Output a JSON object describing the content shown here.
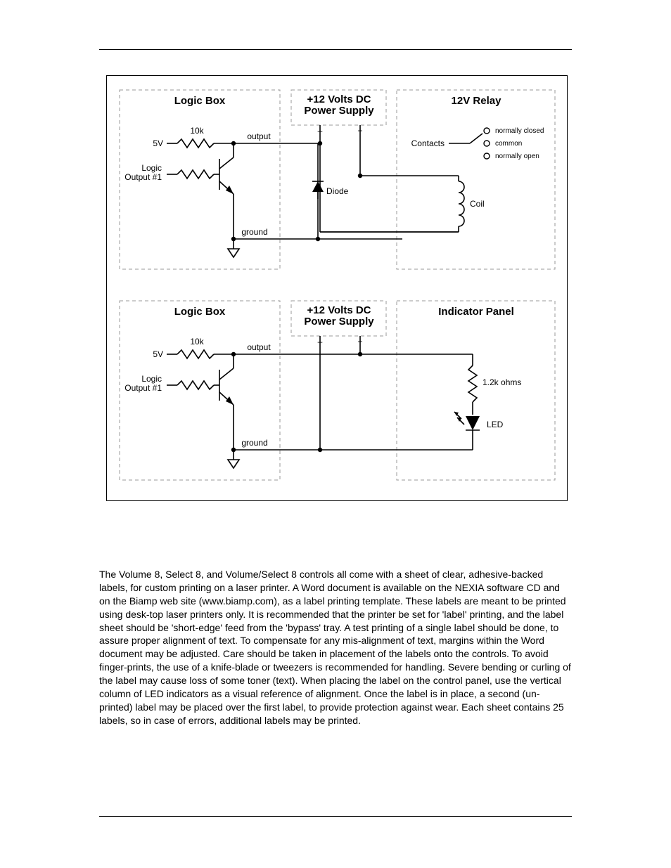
{
  "diagrams": {
    "top": {
      "logic_box_title": "Logic Box",
      "power_supply_title": "+12 Volts DC\nPower Supply",
      "right_title": "12V Relay",
      "r1_value": "10k",
      "output_label": "output",
      "v_label": "5V",
      "logic_output_label": "Logic\nOutput #1",
      "ground_label": "ground",
      "diode_label": "Diode",
      "coil_label": "Coil",
      "contacts_label": "Contacts",
      "nc_label": "normally closed",
      "common_label": "common",
      "no_label": "normally open",
      "ps_minus": "–",
      "ps_plus": "+"
    },
    "bottom": {
      "logic_box_title": "Logic Box",
      "power_supply_title": "+12 Volts DC\nPower Supply",
      "right_title": "Indicator Panel",
      "r1_value": "10k",
      "output_label": "output",
      "v_label": "5V",
      "logic_output_label": "Logic\nOutput #1",
      "ground_label": "ground",
      "r2_label": "1.2k ohms",
      "led_label": "LED",
      "ps_minus": "–",
      "ps_plus": "+"
    }
  },
  "paragraph": "The Volume 8, Select 8, and Volume/Select 8 controls all come with a sheet of clear, adhesive-backed labels, for custom printing on a laser printer. A Word document is available on the NEXIA software CD and on the Biamp web site (www.biamp.com), as a label printing template. These labels are meant to be printed using desk-top laser printers only. It is recommended that the printer be set for 'label' printing, and the label sheet should be 'short-edge' feed from the 'bypass' tray. A test printing of a single label should be done, to assure proper alignment of text. To compensate for any mis-alignment of text, margins within the Word document may be adjusted. Care should be taken in placement of the labels onto the controls. To avoid finger-prints, the use of a knife-blade or tweezers is recommended for handling. Severe bending or curling of the label may cause loss of some toner (text). When placing the label on the control panel, use the vertical column of LED indicators as a visual reference of alignment. Once the label is in place, a second (un-printed) label may be placed over the first label, to provide protection against wear. Each sheet contains 25 labels, so in case of errors, additional labels may be printed."
}
